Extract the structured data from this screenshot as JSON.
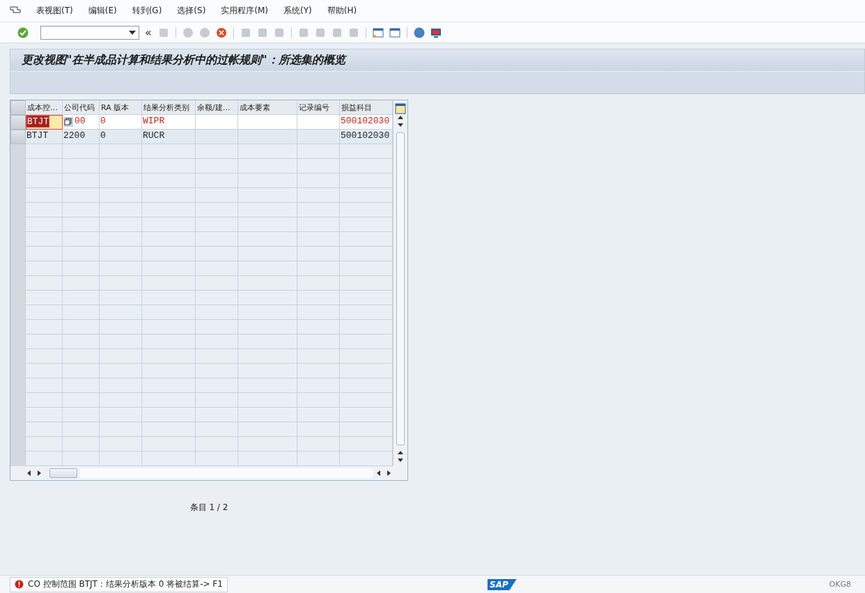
{
  "menu": [
    {
      "label": "表视图(T)"
    },
    {
      "label": "编辑(E)"
    },
    {
      "label": "转到(G)"
    },
    {
      "label": "选择(S)"
    },
    {
      "label": "实用程序(M)"
    },
    {
      "label": "系统(Y)"
    },
    {
      "label": "帮助(H)"
    }
  ],
  "toolbar": {
    "back_label": "«"
  },
  "title": "更改视图\"在半成品计算和结果分析中的过帐规则\"：所选集的概览",
  "table": {
    "columns": [
      "成本控…",
      "公司代码",
      "RA 版本",
      "结果分析类别",
      "余额/建…",
      "成本要素",
      "记录编号",
      "损益科目"
    ],
    "rows": [
      {
        "error": true,
        "focused": true,
        "cells": [
          "BTJT",
          "00",
          "0",
          "WIPR",
          "",
          "",
          "",
          "500102030"
        ]
      },
      {
        "error": false,
        "focused": false,
        "cells": [
          "BTJT",
          "2200",
          "0",
          "RUCR",
          "",
          "",
          "",
          "500102030"
        ]
      }
    ]
  },
  "entries": "条目 1 / 2",
  "status": {
    "message": "CO 控制范围 BTJT：结果分析版本 0 将被结算-> F1",
    "logo": "SAP",
    "transaction": "OKG8"
  }
}
